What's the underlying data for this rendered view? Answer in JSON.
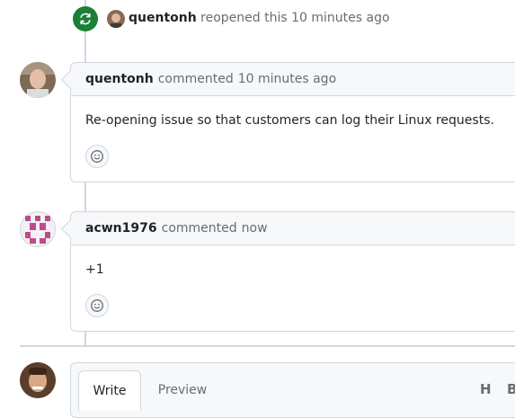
{
  "reopen_event": {
    "author": "quentonh",
    "action": "reopened this",
    "time": "10 minutes ago"
  },
  "comments": [
    {
      "author": "quentonh",
      "action": "commented",
      "time": "10 minutes ago",
      "body": "Re-opening issue so that customers can log their Linux requests."
    },
    {
      "author": "acwn1976",
      "action": "commented",
      "time": "now",
      "body": "+1"
    }
  ],
  "editor": {
    "tabs": [
      "Write",
      "Preview"
    ],
    "toolbar": [
      "H",
      "B"
    ]
  },
  "colors": {
    "reopen_badge": "#1a7f37",
    "identicon": "#c04a8f",
    "border": "#d0d7de",
    "header_bg": "#f6f8fa"
  }
}
